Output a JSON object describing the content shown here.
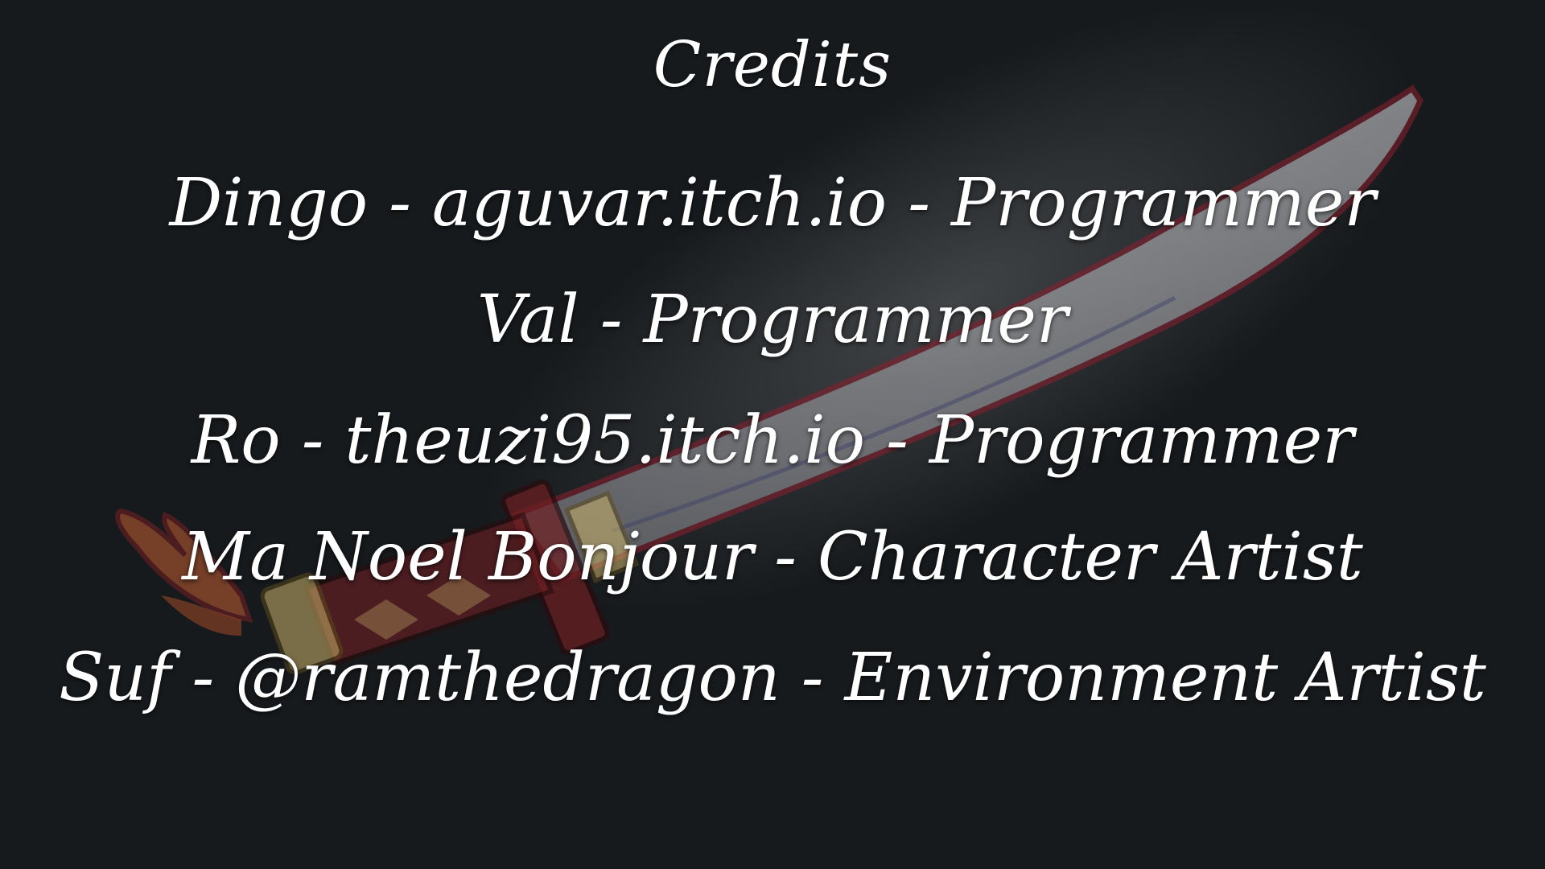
{
  "screen": {
    "background_color": "#171a1d",
    "text_color": "#ffffff"
  },
  "credits": {
    "title": "Credits",
    "lines": [
      "Dingo - aguvar.itch.io - Programmer",
      "Val - Programmer",
      "Ro - theuzi95.itch.io - Programmer",
      "Ma Noel Bonjour - Character Artist",
      "Suf - @ramthedragon - Environment Artist"
    ]
  },
  "background_art": {
    "icon": "sword-icon",
    "blade_color": "#cfcfd2",
    "edge_color": "#8c1e2e",
    "hilt_color": "#6e1f22",
    "guard_color": "#c9b36a",
    "tassel_color": "#b5582f"
  }
}
